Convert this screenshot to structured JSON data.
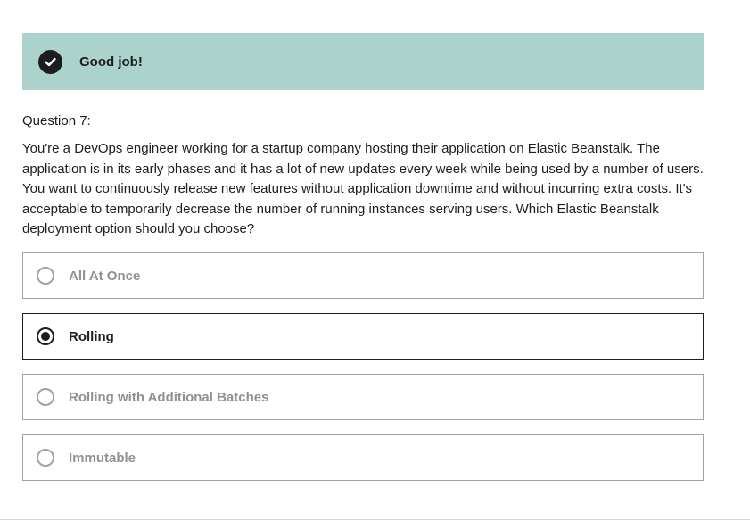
{
  "banner": {
    "icon": "check-circle-icon",
    "message": "Good job!",
    "color": "#acd2cc"
  },
  "question": {
    "label": "Question 7:",
    "text": "You're a DevOps engineer working for a startup company hosting their application on Elastic Beanstalk. The application is in its early phases and it has a lot of new updates every week while being used by a number of users. You want to continuously release new features without application downtime and without incurring extra costs. It's acceptable to temporarily decrease the number of running instances serving users. Which Elastic Beanstalk deployment option should you choose?"
  },
  "options": [
    {
      "label": "All At Once",
      "selected": false
    },
    {
      "label": "Rolling",
      "selected": true
    },
    {
      "label": "Rolling with Additional Batches",
      "selected": false
    },
    {
      "label": "Immutable",
      "selected": false
    }
  ]
}
